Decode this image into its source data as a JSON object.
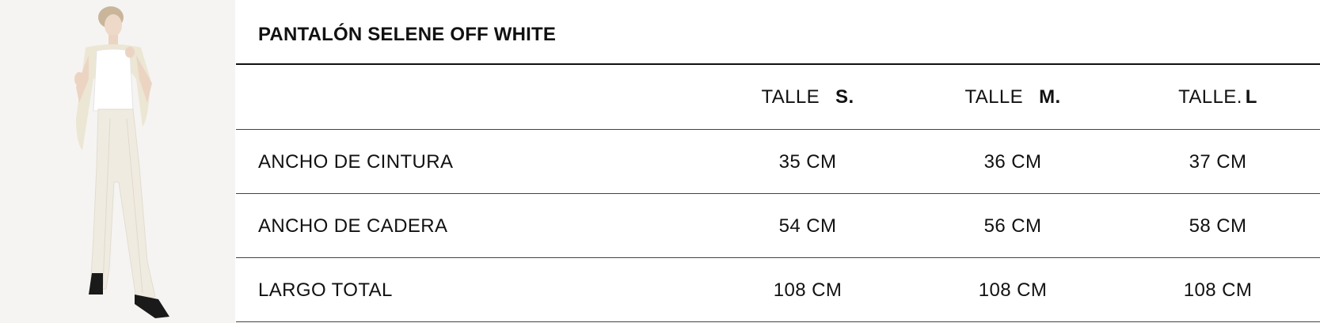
{
  "product": {
    "title": "PANTALÓN SELENE OFF WHITE",
    "photo_alt": "Modelo con pantalón off white"
  },
  "header": {
    "sizes": [
      {
        "prefix": "TALLE",
        "letter": "S."
      },
      {
        "prefix": "TALLE",
        "letter": "M."
      },
      {
        "prefix": "TALLE.",
        "letter": "L"
      }
    ]
  },
  "rows": [
    {
      "label": "ANCHO DE CINTURA",
      "values": [
        "35 CM",
        "36 CM",
        "37 CM"
      ]
    },
    {
      "label": "ANCHO DE CADERA",
      "values": [
        "54 CM",
        "56 CM",
        "58 CM"
      ]
    },
    {
      "label": "LARGO TOTAL",
      "values": [
        "108 CM",
        "108 CM",
        "108 CM"
      ]
    }
  ],
  "colors": {
    "text": "#111111",
    "rule": "#444444",
    "photo_bg": "#f4f3f1",
    "garment": "#efebe0"
  }
}
